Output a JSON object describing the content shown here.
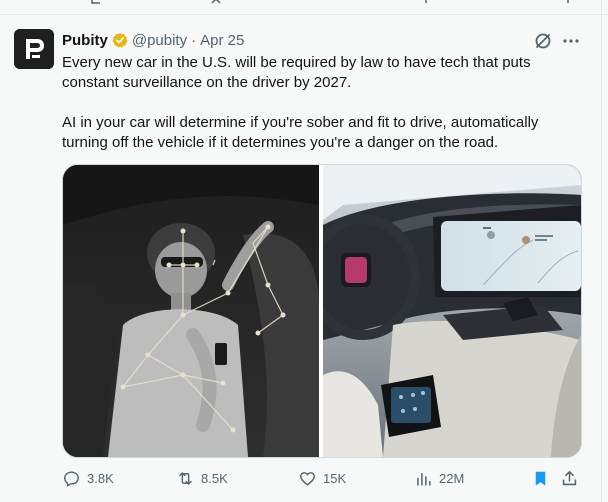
{
  "tweet": {
    "author_name": "Pubity",
    "handle": "@pubity",
    "separator": "·",
    "date": "Apr 25",
    "paragraphs": [
      "Every new car in the U.S. will be required by law to have tech that puts constant surveillance on the driver by 2027.",
      "AI in your car will determine if you're sober and fit to drive, automatically turning off the vehicle if it determines you're a danger on the road."
    ]
  },
  "actions": {
    "replies": "3.8K",
    "reposts": "8.5K",
    "likes": "15K",
    "views": "22M"
  },
  "icons": {
    "avatar": "pubity-logo",
    "verified": "gold-verified-badge",
    "grok": "grok-icon",
    "more": "more-icon",
    "reply": "reply-icon",
    "repost": "repost-icon",
    "like": "like-icon",
    "views": "views-icon",
    "bookmark": "bookmark-icon",
    "share": "share-icon"
  },
  "colors": {
    "text": "#0f1419",
    "secondary": "#536471",
    "bookmark_active": "#1d9bf0",
    "verified_gold": "#e2b719",
    "background": "#f7f9f9"
  }
}
